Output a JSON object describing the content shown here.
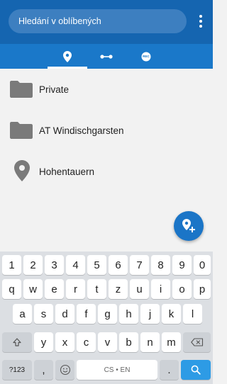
{
  "search": {
    "placeholder": "Hledání v oblíbených"
  },
  "tabs": [
    {
      "icon": "map-pin-icon",
      "active": true
    },
    {
      "icon": "route-icon",
      "active": false
    },
    {
      "icon": "rec-icon",
      "active": false
    }
  ],
  "rec_badge": "REC",
  "list": [
    {
      "type": "folder",
      "label": "Private"
    },
    {
      "type": "folder",
      "label": "AT Windischgarsten"
    },
    {
      "type": "place",
      "label": "Hohentauern"
    }
  ],
  "keyboard": {
    "row1": [
      "1",
      "2",
      "3",
      "4",
      "5",
      "6",
      "7",
      "8",
      "9",
      "0"
    ],
    "row2": [
      "q",
      "w",
      "e",
      "r",
      "t",
      "z",
      "u",
      "i",
      "o",
      "p"
    ],
    "row3": [
      "a",
      "s",
      "d",
      "f",
      "g",
      "h",
      "j",
      "k",
      "l"
    ],
    "row4": [
      "y",
      "x",
      "c",
      "v",
      "b",
      "n",
      "m"
    ],
    "symbols_label": "?123",
    "comma": ",",
    "space_label": "CS • EN",
    "period": "."
  },
  "colors": {
    "appbar": "#1565b0",
    "tabbar": "#1a78c9",
    "accent": "#1b75c7",
    "icon_grey": "#7a7a7a"
  }
}
